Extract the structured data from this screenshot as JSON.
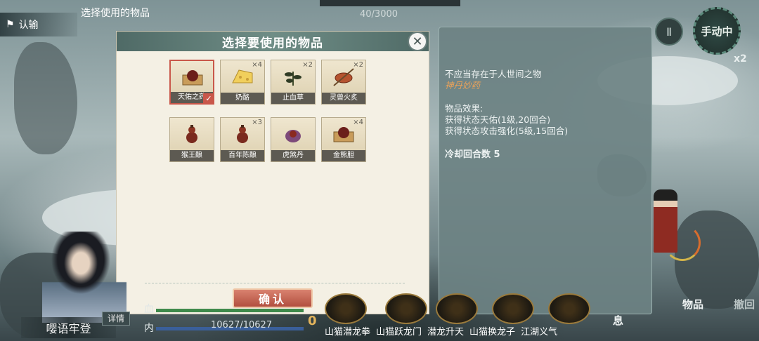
{
  "top": {
    "screen_title": "选择使用的物品",
    "forfeit_label": "认输",
    "counter": "40/3000",
    "pause_icon": "Ⅱ",
    "manual_label": "手动中",
    "speed": "x2"
  },
  "dialog": {
    "title": "选择要使用的物品",
    "confirm_label": "确认",
    "items": [
      {
        "name": "天佑之药",
        "qty": "",
        "selected": true,
        "icon": "pill-box-icon"
      },
      {
        "name": "奶酪",
        "qty": "×4",
        "selected": false,
        "icon": "cheese-icon"
      },
      {
        "name": "止血草",
        "qty": "×2",
        "selected": false,
        "icon": "herb-icon"
      },
      {
        "name": "灵兽火炙",
        "qty": "×2",
        "selected": false,
        "icon": "roast-icon"
      },
      {
        "name": "猴王酿",
        "qty": "",
        "selected": false,
        "icon": "wine-gourd-icon"
      },
      {
        "name": "百年陈酿",
        "qty": "×3",
        "selected": false,
        "icon": "wine-gourd-icon"
      },
      {
        "name": "虎煞丹",
        "qty": "",
        "selected": false,
        "icon": "pill-pouch-icon"
      },
      {
        "name": "金熊胆",
        "qty": "×4",
        "selected": false,
        "icon": "pill-box-icon"
      }
    ]
  },
  "detail": {
    "flavor": "不应当存在于人世间之物",
    "item_name": "神丹妙药",
    "effect_header": "物品效果:",
    "effect_1": "获得状态天佑(1级,20回合)",
    "effect_2": "获得状态攻击强化(5级,15回合)",
    "cooldown": "冷却回合数 5"
  },
  "hud": {
    "character_name": "嘤语牢登",
    "detail_button": "详情",
    "hp_label": "血",
    "inner_label": "内",
    "inner_value": "10627/10627",
    "coin_value": "0",
    "skills": [
      "山猫潜龙拳",
      "山猫跃龙门",
      "潜龙升天",
      "山猫换龙子",
      "江湖义气"
    ],
    "item_button": "物品",
    "undo_button": "撤回",
    "rest_label": "息"
  },
  "colors": {
    "accent_red": "#c9574a",
    "header_teal": "#5b7873",
    "item_name_orange": "#e9a25a",
    "panel_bg": "#6c8283"
  }
}
